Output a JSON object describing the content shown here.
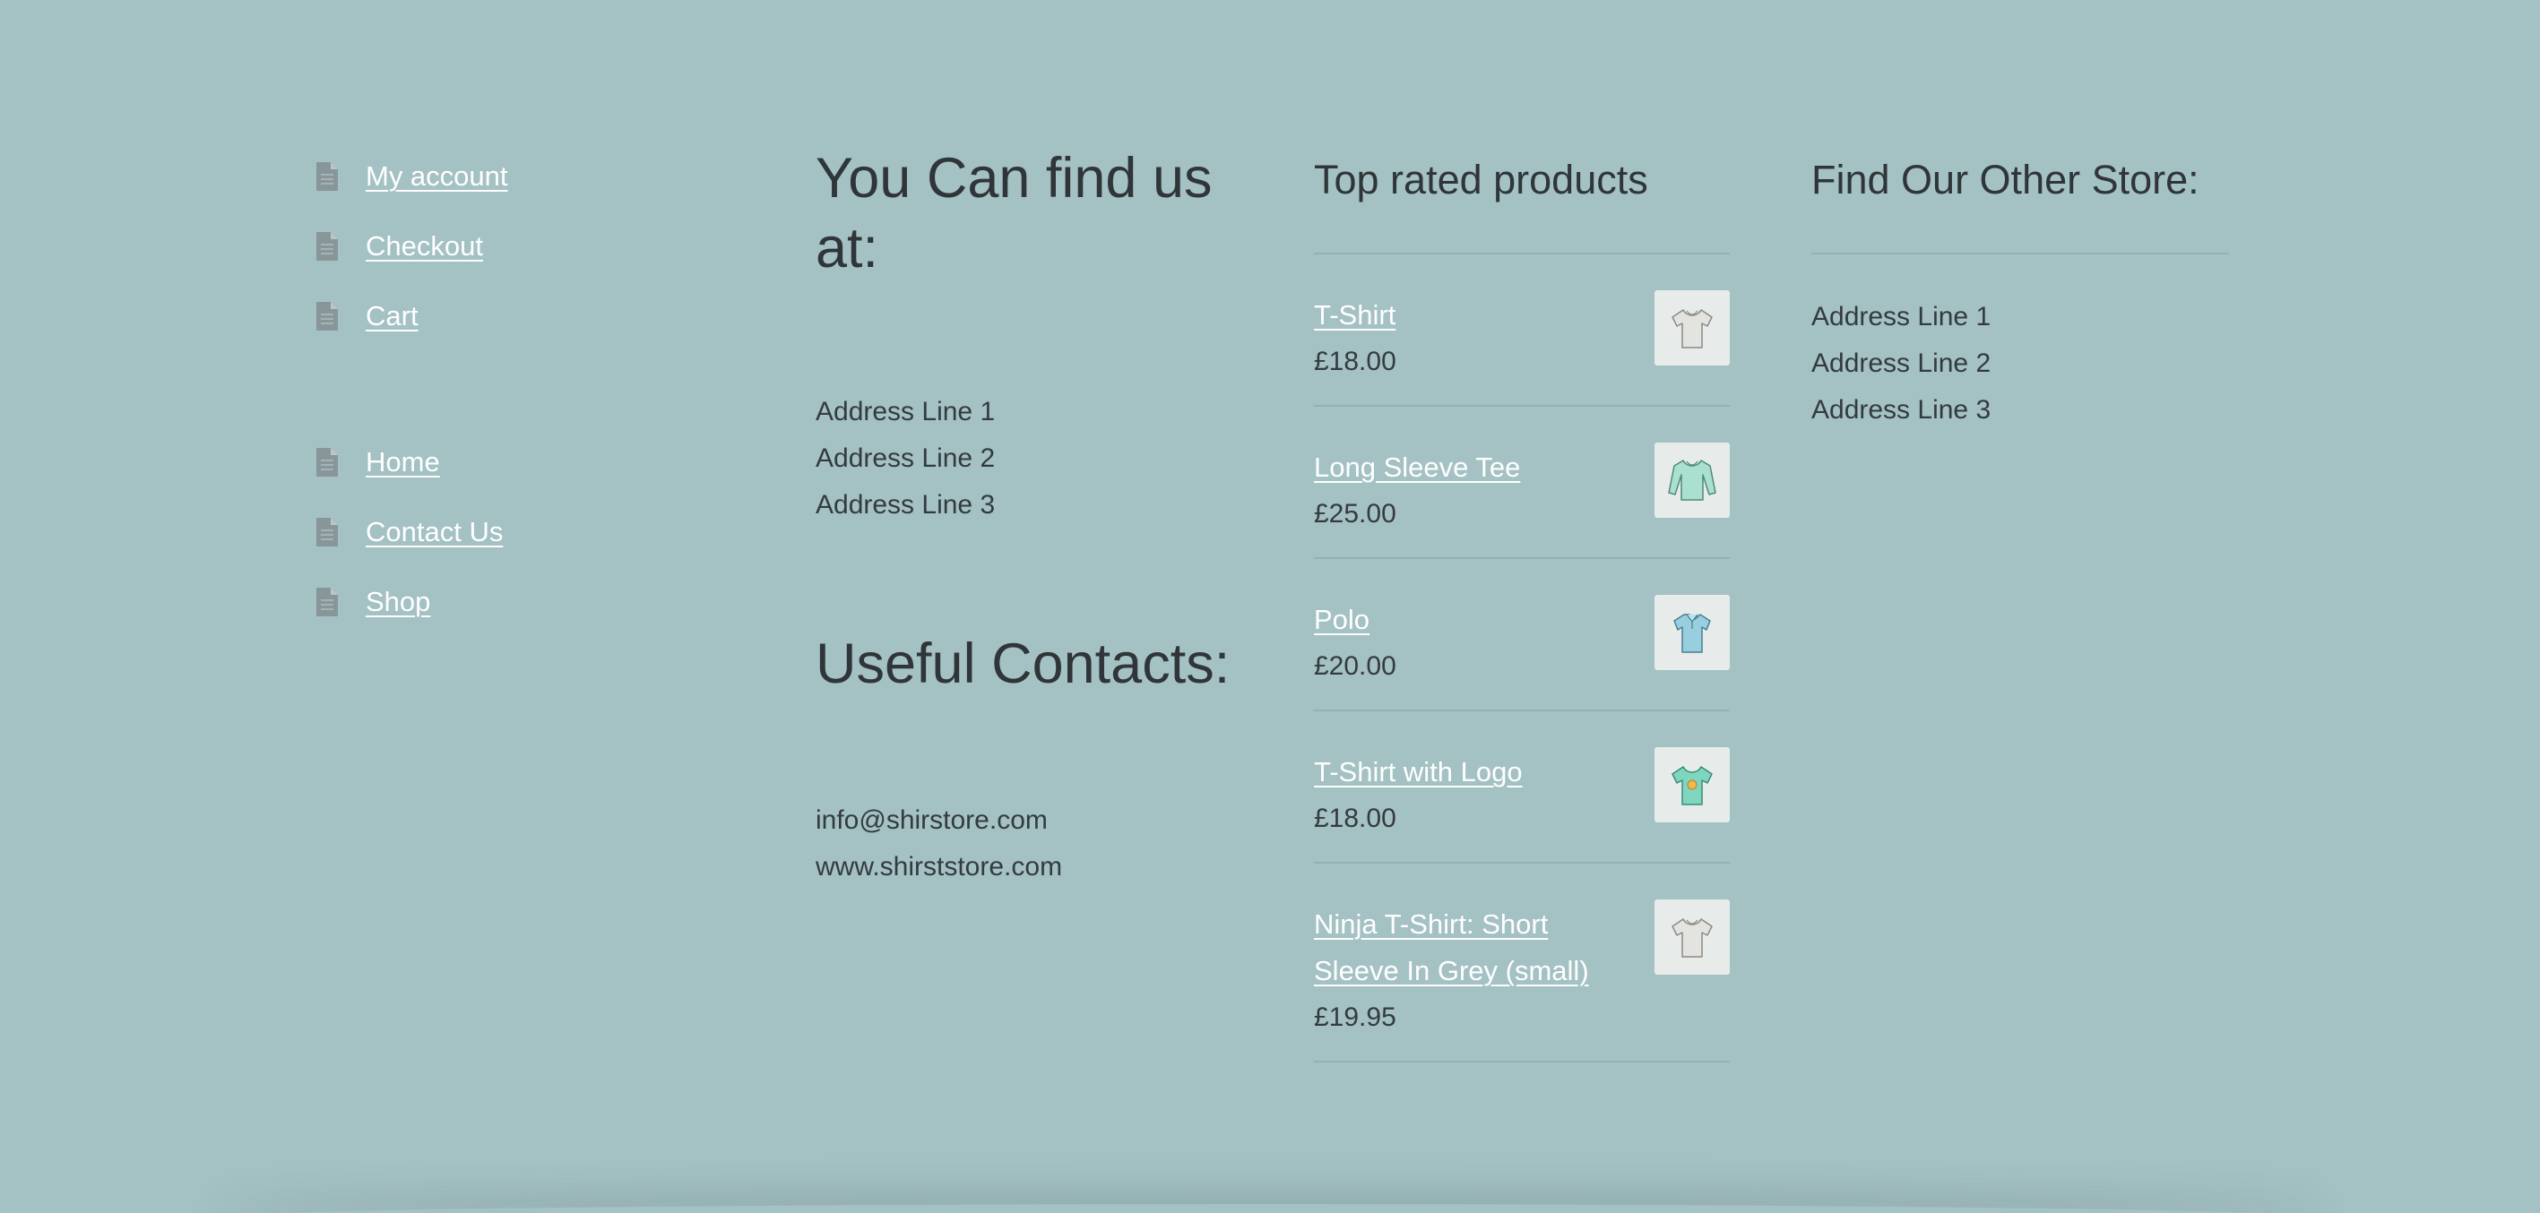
{
  "menus": {
    "account_menu": [
      {
        "label": "My account"
      },
      {
        "label": "Checkout"
      },
      {
        "label": "Cart"
      }
    ],
    "site_menu": [
      {
        "label": "Home"
      },
      {
        "label": "Contact Us"
      },
      {
        "label": "Shop"
      }
    ]
  },
  "find_us": {
    "heading": "You Can find us at:",
    "address": [
      "Address Line 1",
      "Address Line 2",
      "Address Line 3"
    ]
  },
  "contacts": {
    "heading": "Useful Contacts:",
    "email": "info@shirstore.com",
    "website": "www.shirststore.com"
  },
  "top_rated": {
    "heading": "Top rated products",
    "products": [
      {
        "name": "T-Shirt",
        "price": "£18.00",
        "thumb_icon": "grey-tshirt-icon"
      },
      {
        "name": "Long Sleeve Tee",
        "price": "£25.00",
        "thumb_icon": "long-sleeve-tee-icon"
      },
      {
        "name": "Polo",
        "price": "£20.00",
        "thumb_icon": "polo-shirt-icon"
      },
      {
        "name": "T-Shirt with Logo",
        "price": "£18.00",
        "thumb_icon": "logo-tshirt-icon"
      },
      {
        "name": "Ninja T-Shirt: Short Sleeve In Grey (small)",
        "price": "£19.95",
        "thumb_icon": "grey-tshirt-icon"
      }
    ]
  },
  "other_store": {
    "heading": "Find Our Other Store:",
    "address": [
      "Address Line 1",
      "Address Line 2",
      "Address Line 3"
    ]
  },
  "colors": {
    "background": "#a4c1c4",
    "link": "#ffffff",
    "text": "#343b40",
    "divider": "#93b0b3",
    "thumb_bg": "#e7eceb"
  }
}
